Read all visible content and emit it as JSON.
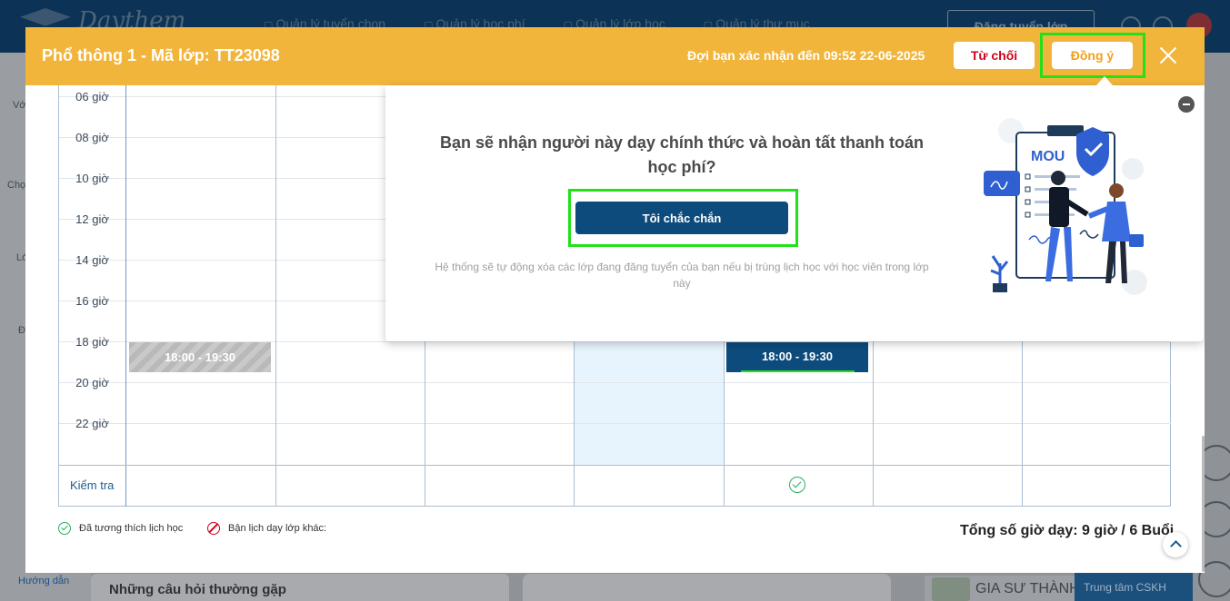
{
  "background": {
    "logo_text": "Daythem",
    "nav": [
      "Quản lý tuyển chọn",
      "Quản lý học phí",
      "Quản lý lớp học",
      "Quản lý thư mục"
    ],
    "cta_label": "Đăng tuyển lớp",
    "sidebar_labels": [
      "Vớ",
      "Chọ",
      "Lớ",
      "Đ"
    ],
    "guide_label": "Hướng dẫn",
    "faq_title": "Những câu hỏi thường gặp",
    "badge_text": "GIA SƯ THÀNH",
    "support_label": "Trung tâm CSKH"
  },
  "modal": {
    "title": "Phổ thông 1 - Mã lớp: TT23098",
    "deadline": "Đợi bạn xác nhận đến 09:52 22-06-2025",
    "reject_label": "Từ chối",
    "accept_label": "Đồng ý"
  },
  "schedule": {
    "hours": [
      "06 giờ",
      "08 giờ",
      "10 giờ",
      "12 giờ",
      "14 giờ",
      "16 giờ",
      "18 giờ",
      "20 giờ",
      "22 giờ"
    ],
    "check_label": "Kiểm tra",
    "busy_slot": "18:00 - 19:30",
    "ok_slot": "18:00 - 19:30"
  },
  "legend": {
    "compatible": "Đã tương thích lịch học",
    "conflict": "Bận lịch dạy lớp khác:"
  },
  "total": "Tổng số giờ dạy: 9 giờ / 6 Buổi",
  "confirm": {
    "question": "Bạn sẽ nhận người này dạy chính thức và hoàn tất thanh toán học phí?",
    "sure_label": "Tôi chắc chắn",
    "note": "Hệ thống sẽ tự động xóa các lớp đang đăng tuyển của bạn nếu bị trùng lịch học với học viên trong lớp này",
    "illustration_text": "MOU"
  },
  "colors": {
    "header_bg": "#f2b53c",
    "primary": "#0d4b7c",
    "reject_text": "#d0021b",
    "highlight": "#22e01a"
  }
}
